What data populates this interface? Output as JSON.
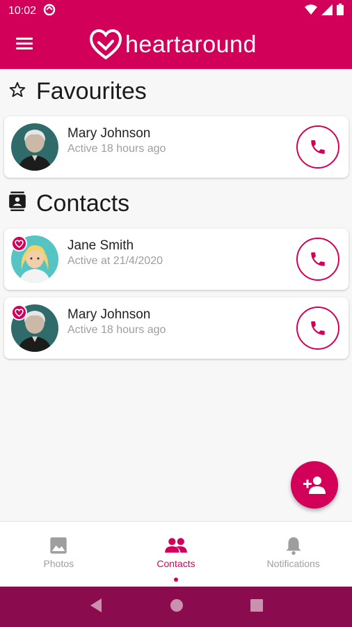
{
  "status_bar": {
    "time": "10:02"
  },
  "app_bar": {
    "logo_text": "heartaround"
  },
  "favourites": {
    "title": "Favourites",
    "items": [
      {
        "name": "Mary Johnson",
        "status": "Active 18 hours ago",
        "avatar": "elderly-woman-avatar",
        "heart_badge": false
      }
    ]
  },
  "contacts": {
    "title": "Contacts",
    "items": [
      {
        "name": "Jane Smith",
        "status": "Active at 21/4/2020",
        "avatar": "blonde-woman-avatar",
        "heart_badge": true
      },
      {
        "name": "Mary Johnson",
        "status": "Active 18 hours ago",
        "avatar": "elderly-woman-avatar",
        "heart_badge": true
      }
    ]
  },
  "bottom_nav": {
    "items": [
      {
        "label": "Photos",
        "icon": "photo-icon",
        "active": false
      },
      {
        "label": "Contacts",
        "icon": "people-icon",
        "active": true
      },
      {
        "label": "Notifications",
        "icon": "bell-icon",
        "active": false
      }
    ]
  },
  "colors": {
    "accent": "#d3005a",
    "system_nav": "#8b0c4e",
    "muted": "#9e9e9e"
  }
}
